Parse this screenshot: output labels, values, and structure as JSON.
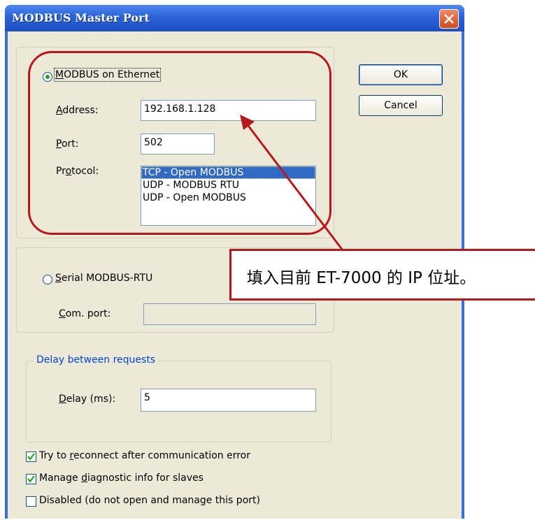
{
  "window": {
    "title": "MODBUS Master Port"
  },
  "ethernet": {
    "radio_label_parts": [
      "",
      "M",
      "ODBUS on Ethernet"
    ],
    "address_label_parts": [
      "",
      "A",
      "ddress:"
    ],
    "address_value": "192.168.1.128",
    "port_label_parts": [
      "",
      "P",
      "ort:"
    ],
    "port_value": "502",
    "protocol_label_parts": [
      "Pr",
      "o",
      "tocol:"
    ],
    "protocols": [
      "TCP - Open MODBUS",
      "UDP - MODBUS RTU",
      "UDP - Open MODBUS"
    ],
    "selected_protocol": "TCP - Open MODBUS"
  },
  "serial": {
    "radio_label_parts": [
      "",
      "S",
      "erial MODBUS-RTU"
    ],
    "com_port_label_parts": [
      "",
      "C",
      "om. port:"
    ],
    "com_port_value": ""
  },
  "delay": {
    "group_title": "Delay between requests",
    "label_parts": [
      "",
      "D",
      "elay (ms):"
    ],
    "value": "5"
  },
  "options": {
    "reconnect_parts": [
      "Try to ",
      "r",
      "econnect after communication error"
    ],
    "diagnostic_parts": [
      "Manage ",
      "d",
      "iagnostic info for slaves"
    ],
    "disabled_label": "Disabled (do not open and manage this port)"
  },
  "buttons": {
    "ok": "OK",
    "cancel": "Cancel"
  },
  "annotation": {
    "callout_text": "填入目前 ET-7000 的 IP 位址。"
  },
  "state": {
    "ethernet_selected": true,
    "reconnect_checked": true,
    "diagnostic_checked": true,
    "disabled_checked": false
  },
  "colors": {
    "annotation": "#b81818",
    "title_bar": "#2b63d8",
    "dialog_face": "#ece9d8",
    "selection": "#316ac5",
    "radio_dot": "#21a121"
  }
}
